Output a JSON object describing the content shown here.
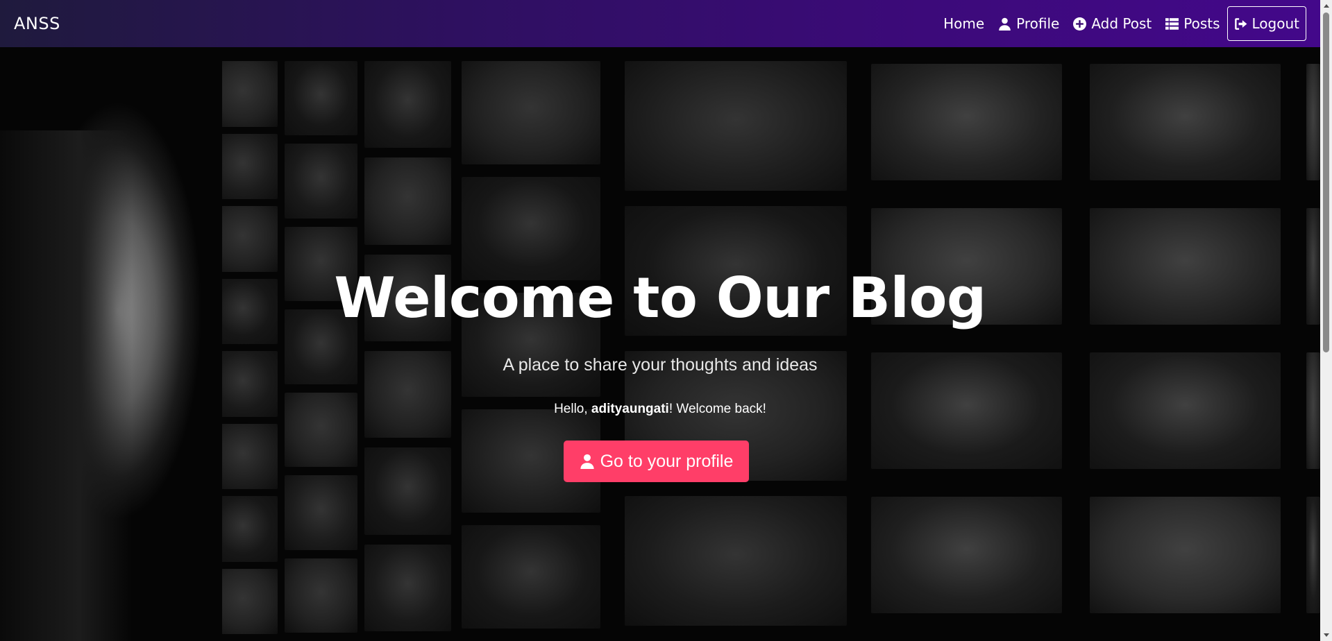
{
  "navbar": {
    "brand": "ANSS",
    "links": {
      "home": "Home",
      "profile": "Profile",
      "add_post": "Add Post",
      "posts": "Posts",
      "logout": "Logout"
    }
  },
  "hero": {
    "title": "Welcome to Our Blog",
    "subtitle": "A place to share your thoughts and ideas",
    "greeting_prefix": "Hello, ",
    "username": "adityaungati",
    "greeting_suffix": "! Welcome back!",
    "cta_label": "Go to your profile"
  },
  "colors": {
    "cta_background": "#ff3e68",
    "navbar_gradient_start": "#1f1a3d",
    "navbar_gradient_end": "#43088a"
  },
  "icons": {
    "profile": "user-icon",
    "add_post": "plus-circle-icon",
    "posts": "list-icon",
    "logout": "sign-out-icon"
  }
}
